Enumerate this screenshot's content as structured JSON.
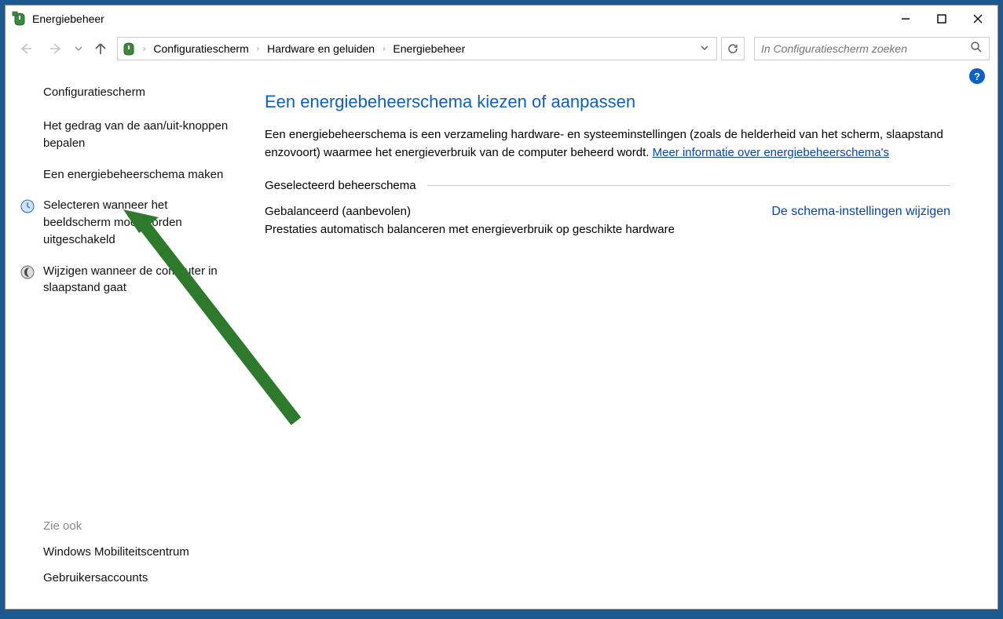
{
  "window": {
    "title": "Energiebeheer"
  },
  "breadcrumb": {
    "items": [
      "Configuratiescherm",
      "Hardware en geluiden",
      "Energiebeheer"
    ]
  },
  "search": {
    "placeholder": "In Configuratiescherm zoeken"
  },
  "sidebar": {
    "home": "Configuratiescherm",
    "links": [
      "Het gedrag van de aan/uit-knoppen bepalen",
      "Een energiebeheerschema maken",
      "Selecteren wanneer het beeldscherm moet worden uitgeschakeld",
      "Wijzigen wanneer de computer in slaapstand gaat"
    ],
    "see_also_label": "Zie ook",
    "see_also": [
      "Windows Mobiliteitscentrum",
      "Gebruikersaccounts"
    ]
  },
  "main": {
    "heading": "Een energiebeheerschema kiezen of aanpassen",
    "description_pre": "Een energiebeheerschema is een verzameling hardware- en systeeminstellingen (zoals de helderheid van het scherm, slaapstand enzovoort) waarmee het energieverbruik van de computer beheerd wordt. ",
    "description_link": "Meer informatie over energiebeheerschema's",
    "section_label": "Geselecteerd beheerschema",
    "plan": {
      "name": "Gebalanceerd (aanbevolen)",
      "desc": "Prestaties automatisch balanceren met energieverbruik op geschikte hardware",
      "change_link": "De schema-instellingen wijzigen"
    }
  }
}
